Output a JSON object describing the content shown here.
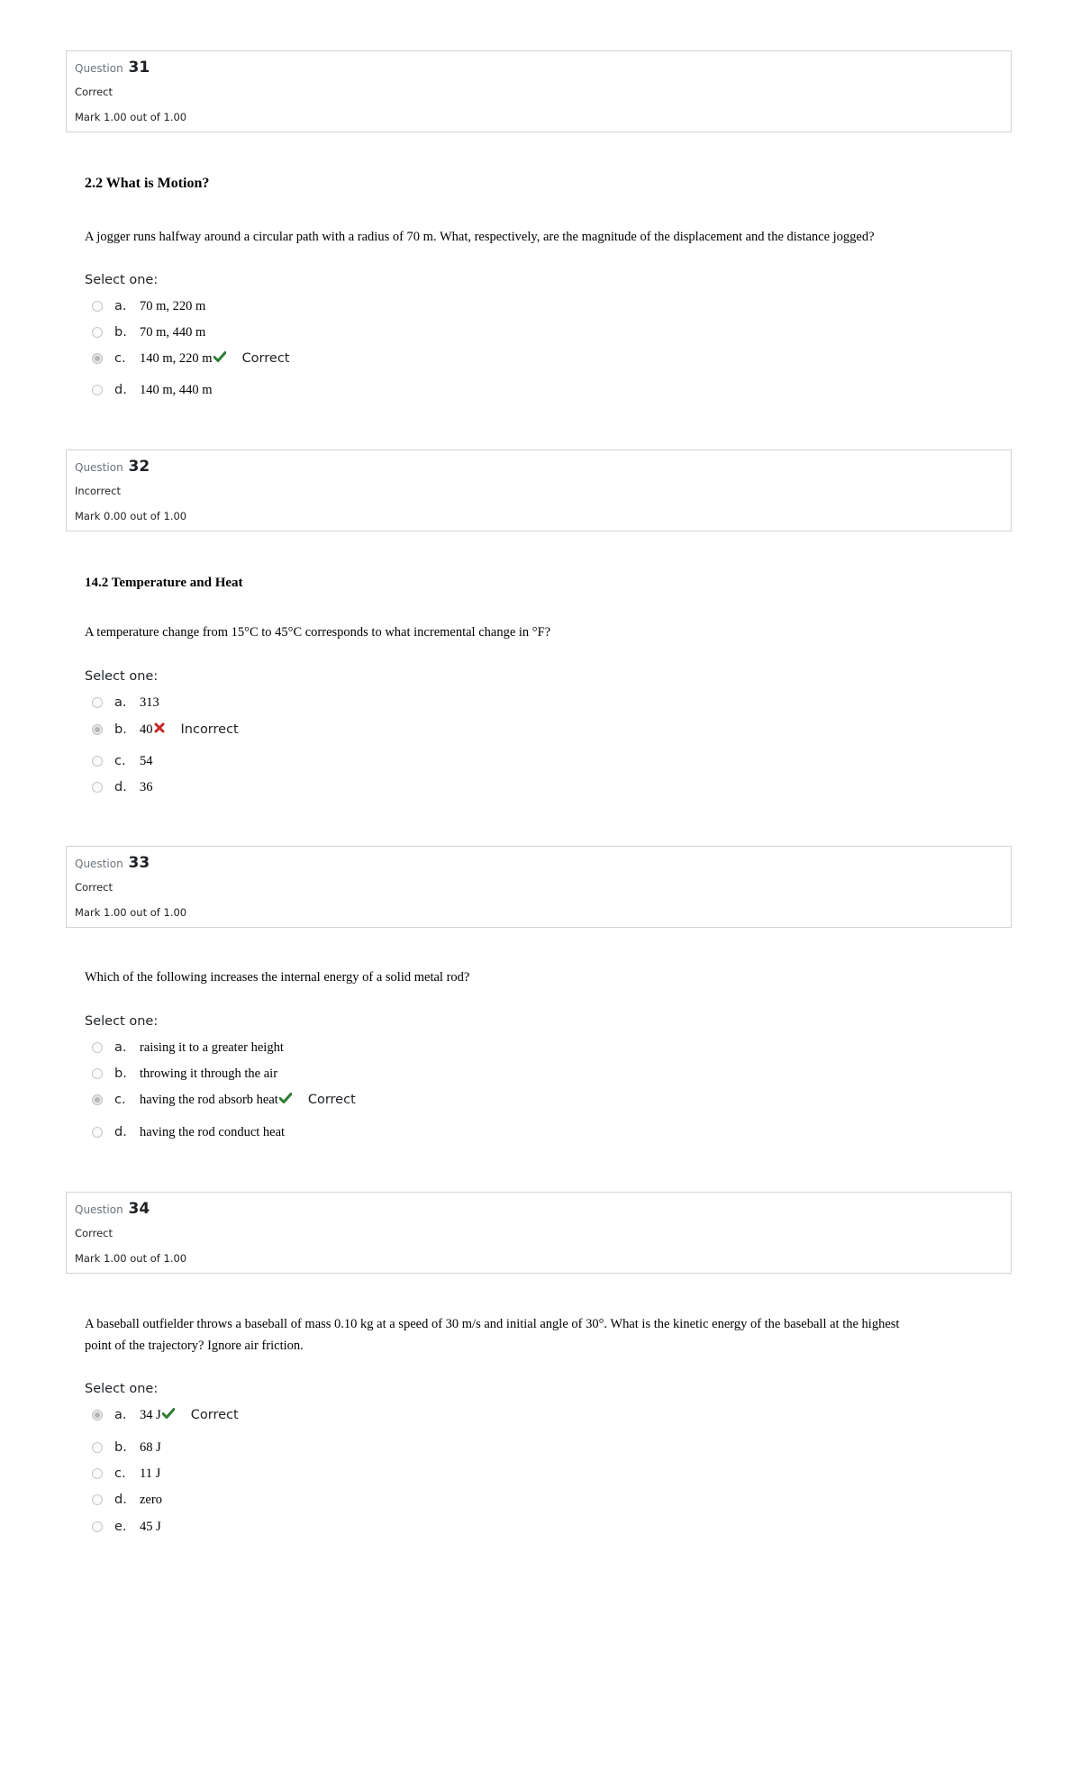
{
  "questions": [
    {
      "label": "Question",
      "number": "31",
      "state": "Correct",
      "grade": "Mark 1.00 out of 1.00",
      "heading": "2.2 What is Motion?",
      "text": "A jogger runs halfway around a circular path with a radius of 70 m. What, respectively, are the magnitude of the displacement and the distance jogged?",
      "prompt": "Select one:",
      "answers": [
        {
          "letter": "a.",
          "text": "70 m, 220 m",
          "selected": false
        },
        {
          "letter": "b.",
          "text": "70 m, 440 m",
          "selected": false
        },
        {
          "letter": "c.",
          "text": "140 m, 220 m",
          "selected": true,
          "mark_icon": "check-icon",
          "feedback": "Correct"
        },
        {
          "letter": "d.",
          "text": "140 m, 440 m",
          "selected": false
        }
      ]
    },
    {
      "label": "Question",
      "number": "32",
      "state": "Incorrect",
      "grade": "Mark 0.00 out of 1.00",
      "heading": "14.2 Temperature and Heat",
      "text": "A temperature change from 15°C to 45°C corresponds to what incremental change in °F?",
      "prompt": "Select one:",
      "answers": [
        {
          "letter": "a.",
          "text": "313",
          "selected": false
        },
        {
          "letter": "b.",
          "text": "40",
          "selected": true,
          "mark_icon": "cross-icon",
          "feedback": "Incorrect"
        },
        {
          "letter": "c.",
          "text": "54",
          "selected": false
        },
        {
          "letter": "d.",
          "text": "36",
          "selected": false
        }
      ]
    },
    {
      "label": "Question",
      "number": "33",
      "state": "Correct",
      "grade": "Mark 1.00 out of 1.00",
      "text": "Which of the following increases the internal energy of a solid metal rod?",
      "prompt": "Select one:",
      "answers": [
        {
          "letter": "a.",
          "text": "raising it to a greater height",
          "selected": false
        },
        {
          "letter": "b.",
          "text": "throwing it through the air",
          "selected": false
        },
        {
          "letter": "c.",
          "text": "having the rod absorb heat",
          "selected": true,
          "mark_icon": "check-icon",
          "feedback": "Correct"
        },
        {
          "letter": "d.",
          "text": "having the rod conduct heat",
          "selected": false
        }
      ]
    },
    {
      "label": "Question",
      "number": "34",
      "state": "Correct",
      "grade": "Mark 1.00 out of 1.00",
      "text_line1": "A baseball outfielder throws a baseball of mass 0.10 kg at a speed of 30 m/s and initial angle of 30°. What is the kinetic energy of the baseball at the highest",
      "text_line2": "point of the trajectory? Ignore air friction.",
      "prompt": "Select one:",
      "answers": [
        {
          "letter": "a.",
          "text": "34 J",
          "selected": true,
          "mark_icon": "check-icon",
          "feedback": "Correct"
        },
        {
          "letter": "b.",
          "text": "68 J",
          "selected": false
        },
        {
          "letter": "c.",
          "text": "11 J",
          "selected": false
        },
        {
          "letter": "d.",
          "text": "zero",
          "selected": false
        },
        {
          "letter": "e.",
          "text": "45 J",
          "selected": false
        }
      ]
    }
  ],
  "colors": {
    "correct_icon": "#2e7d32",
    "incorrect_icon": "#c62828",
    "box_border": "#cfd4d9",
    "muted_label": "#6a737b"
  }
}
